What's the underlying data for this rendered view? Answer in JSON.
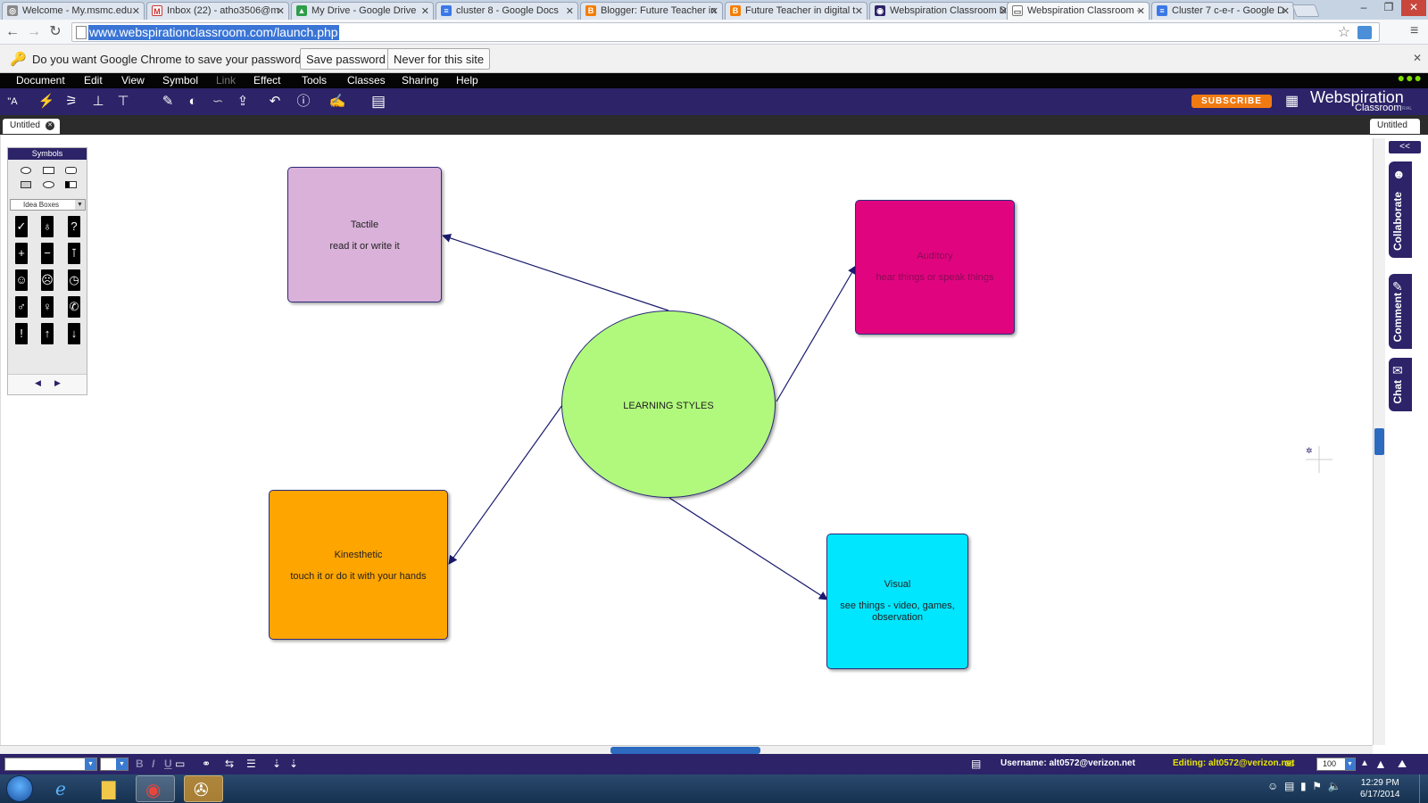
{
  "browser": {
    "tabs": [
      {
        "label": "Welcome - My.msmc.edu",
        "icon": "portal-icon"
      },
      {
        "label": "Inbox (22) - atho3506@m",
        "icon": "gmail-icon"
      },
      {
        "label": "My Drive - Google Drive",
        "icon": "drive-icon"
      },
      {
        "label": "cluster 8 - Google Docs",
        "icon": "docs-icon"
      },
      {
        "label": "Blogger: Future Teacher in",
        "icon": "blogger-icon"
      },
      {
        "label": "Future Teacher in digital t",
        "icon": "blogger-icon"
      },
      {
        "label": "Webspiration Classroom D",
        "icon": "webspiration-icon"
      },
      {
        "label": "Webspiration Classroom -",
        "icon": "page-icon"
      },
      {
        "label": "Cluster 7 c-e-r - Google D",
        "icon": "docs-icon"
      }
    ],
    "active_tab_index": 7,
    "url": "www.webspirationclassroom.com/launch.php",
    "password_prompt": {
      "text": "Do you want Google Chrome to save your password?",
      "save_label": "Save password",
      "never_label": "Never for this site"
    }
  },
  "app": {
    "menu": [
      "Document",
      "Edit",
      "View",
      "Symbol",
      "Link",
      "Effect",
      "Tools",
      "Classes",
      "Sharing",
      "Help"
    ],
    "disabled_menu": [
      "Link"
    ],
    "subscribe_label": "SUBSCRIBE",
    "logo_text": "Webspiration",
    "logo_sub": "Classroom",
    "logo_trial": "TRIAL",
    "doc_tab_label": "Untitled",
    "doc_tab_right_label": "Untitled",
    "symbols_panel": {
      "title": "Symbols",
      "category": "Idea Boxes"
    },
    "side_tabs": [
      "Collaborate",
      "Comment",
      "Chat"
    ],
    "collapse_label": "<<",
    "status": {
      "username": "Username: alt0572@verizon.net",
      "editing": "Editing: alt0572@verizon.net",
      "zoom": "100"
    }
  },
  "diagram": {
    "center": {
      "label": "LEARNING STYLES",
      "color": "#b1f97c"
    },
    "nodes": [
      {
        "id": "tactile",
        "title": "Tactile",
        "desc": "read it or write it",
        "color": "#d9b1d9"
      },
      {
        "id": "auditory",
        "title": "Auditory",
        "desc": "hear things or speak things",
        "color": "#e0057f"
      },
      {
        "id": "kinesthetic",
        "title": "Kinesthetic",
        "desc": "touch it or do it with your hands",
        "color": "#ffa500"
      },
      {
        "id": "visual",
        "title": "Visual",
        "desc": "see things - video, games, observation",
        "color": "#00e6ff"
      }
    ],
    "link_color": "#1a1a6e"
  },
  "taskbar": {
    "time": "12:29 PM",
    "date": "6/17/2014"
  }
}
